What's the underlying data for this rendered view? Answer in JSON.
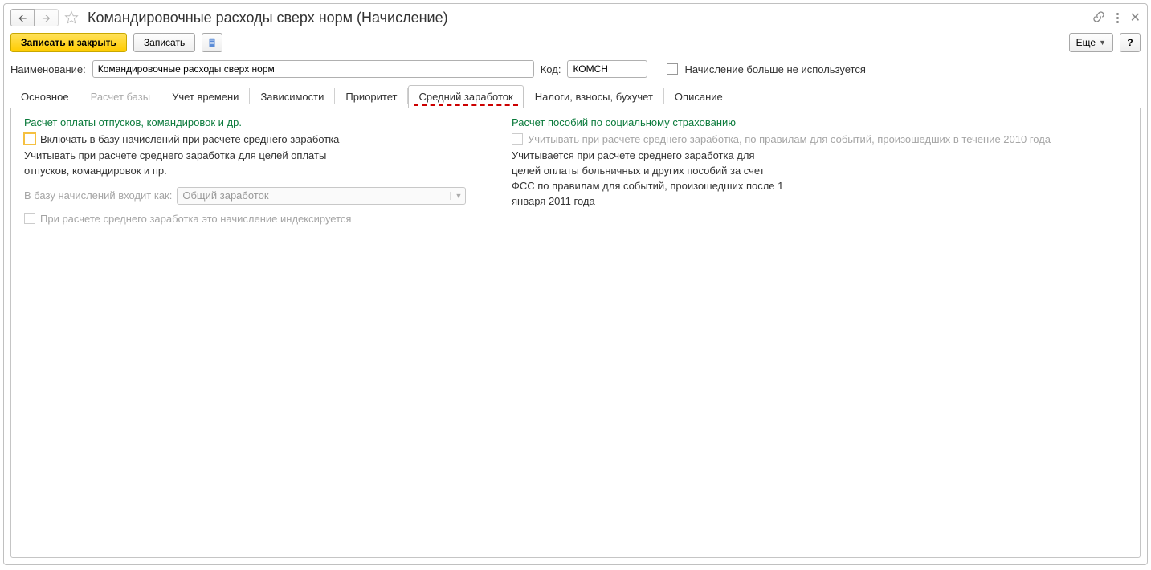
{
  "title": "Командировочные расходы сверх норм (Начисление)",
  "toolbar": {
    "save_close": "Записать и закрыть",
    "save": "Записать",
    "more": "Еще",
    "help": "?"
  },
  "fields": {
    "name_label": "Наименование:",
    "name_value": "Командировочные расходы сверх норм",
    "code_label": "Код:",
    "code_value": "КОМСН",
    "not_used_label": "Начисление больше не используется"
  },
  "tabs": {
    "main": "Основное",
    "base_calc": "Расчет базы",
    "time": "Учет времени",
    "deps": "Зависимости",
    "priority": "Приоритет",
    "avg": "Средний заработок",
    "taxes": "Налоги, взносы, бухучет",
    "desc": "Описание"
  },
  "left": {
    "section": "Расчет оплаты отпусков, командировок и др.",
    "include_label": "Включать в базу начислений при расчете среднего заработка",
    "include_desc": "Учитывать при расчете среднего заработка для целей оплаты отпусков, командировок и пр.",
    "base_as_label": "В базу начислений входит как:",
    "base_as_value": "Общий заработок",
    "index_label": "При расчете среднего заработка это начисление индексируется"
  },
  "right": {
    "section": "Расчет пособий по социальному страхованию",
    "consider_label": "Учитывать при расчете среднего заработка, по правилам для событий, произошедших в течение 2010 года",
    "consider_desc": "Учитывается при расчете среднего заработка для целей оплаты больничных и других пособий за счет ФСС по правилам для событий, произошедших после 1 января 2011 года"
  }
}
